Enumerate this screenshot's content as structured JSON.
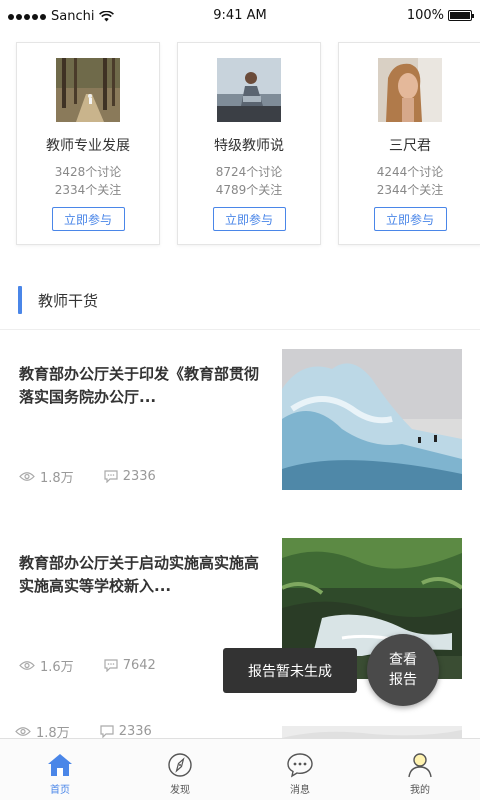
{
  "status_bar": {
    "carrier": "Sanchi",
    "time": "9:41 AM",
    "battery": "100%"
  },
  "topics": [
    {
      "title": "教师专业发展",
      "discussions": "3428个讨论",
      "follows": "2334个关注",
      "button": "立即参与",
      "thumb": "forest-path-thumb"
    },
    {
      "title": "特级教师说",
      "discussions": "8724个讨论",
      "follows": "4789个关注",
      "button": "立即参与",
      "thumb": "person-on-car-thumb"
    },
    {
      "title": "三尺君",
      "discussions": "4244个讨论",
      "follows": "2344个关注",
      "button": "立即参与",
      "thumb": "woman-portrait-thumb"
    }
  ],
  "section": {
    "title": "教师干货"
  },
  "articles": [
    {
      "title": "教育部办公厅关于印发《教育部贯彻落实国务院办公厅...",
      "views": "1.8万",
      "comments": "2336",
      "image": "glacier-penguins-photo"
    },
    {
      "title": "教育部办公厅关于启动实施高实施高实施高实等学校新入...",
      "views": "1.6万",
      "comments": "7642",
      "image": "forest-waterfall-photo"
    },
    {
      "title": "",
      "views": "1.8万",
      "comments": "2336",
      "image": "partial-photo"
    }
  ],
  "toast": {
    "text": "报告暂未生成"
  },
  "fab": {
    "line1": "查看",
    "line2": "报告"
  },
  "tabbar": {
    "items": [
      {
        "label": "首页",
        "icon": "home-icon",
        "active": true
      },
      {
        "label": "发现",
        "icon": "compass-icon",
        "active": false
      },
      {
        "label": "消息",
        "icon": "chat-bubble-icon",
        "active": false
      },
      {
        "label": "我的",
        "icon": "user-icon",
        "active": false
      }
    ]
  },
  "colors": {
    "accent": "#4a86e8",
    "toast_bg": "#333333",
    "fab_bg": "#4a4a4a"
  }
}
